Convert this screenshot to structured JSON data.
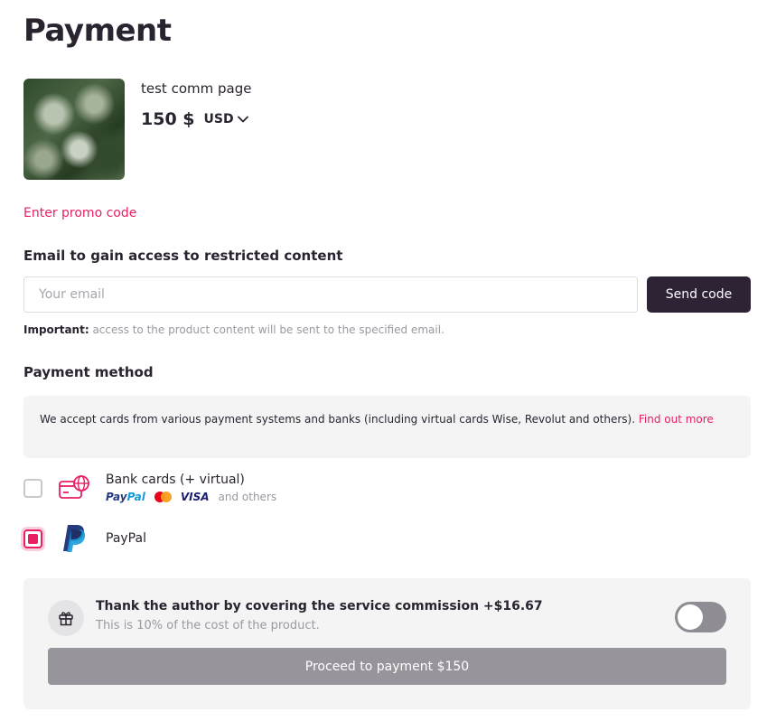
{
  "page": {
    "title": "Payment"
  },
  "product": {
    "name": "test comm page",
    "price": "150 $",
    "currency": "USD"
  },
  "promo": {
    "link_label": "Enter promo code"
  },
  "email": {
    "label": "Email to gain access to restricted content",
    "placeholder": "Your email",
    "value": "",
    "send_button_label": "Send code",
    "note_strong": "Important:",
    "note_text": " access to the product content will be sent to the specified email."
  },
  "payment_method": {
    "title": "Payment method",
    "info_text": "We accept cards from various payment systems and banks (including virtual cards Wise, Revolut and others). ",
    "info_link": "Find out more",
    "methods": [
      {
        "name": "Bank cards (+ virtual)",
        "checked": false,
        "brands": {
          "paypal_a": "Pay",
          "paypal_b": "Pal",
          "visa": "VISA",
          "others": "and others"
        }
      },
      {
        "name": "PayPal",
        "checked": true
      }
    ]
  },
  "commission": {
    "title": "Thank the author by covering the service commission +$16.67",
    "subtitle": "This is 10% of the cost of the product.",
    "toggle_on": false,
    "proceed_label": "Proceed to payment $150"
  },
  "colors": {
    "accent": "#e91e63",
    "dark": "#2e2235",
    "muted": "#9a98a0",
    "panel": "#f4f4f5"
  }
}
